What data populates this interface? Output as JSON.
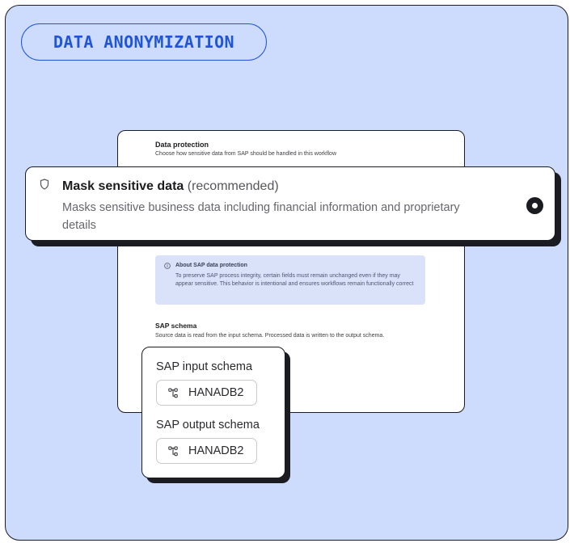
{
  "header": {
    "title": "DATA ANONYMIZATION"
  },
  "protection": {
    "title": "Data protection",
    "subtitle": "Choose how sensitive data from SAP should be handled in this workflow"
  },
  "mask_option": {
    "title": "Mask sensitive data",
    "tag": " (recommended)",
    "description": "Masks sensitive business data including financial information and proprietary details",
    "selected": true
  },
  "info_box": {
    "title": "About SAP data protection",
    "body": "To preserve SAP process integrity, certain fields must remain unchanged even if they may appear sensitive. This behavior is intentional and ensures workflows remain functionally correct"
  },
  "schema": {
    "title": "SAP schema",
    "subtitle": "Source data is read from the input schema. Processed data is written to the output schema.",
    "input_label": "SAP input schema",
    "input_value": "HANADB2",
    "output_label": "SAP output schema",
    "output_value": "HANADB2"
  },
  "icons": {
    "mask": "shield-icon",
    "info": "info-icon",
    "schema": "schema-tree-icon"
  },
  "colors": {
    "background": "#cddcfc",
    "accent": "#2055d8",
    "border": "#1b1c22",
    "info_bg": "#d9e2f8"
  }
}
